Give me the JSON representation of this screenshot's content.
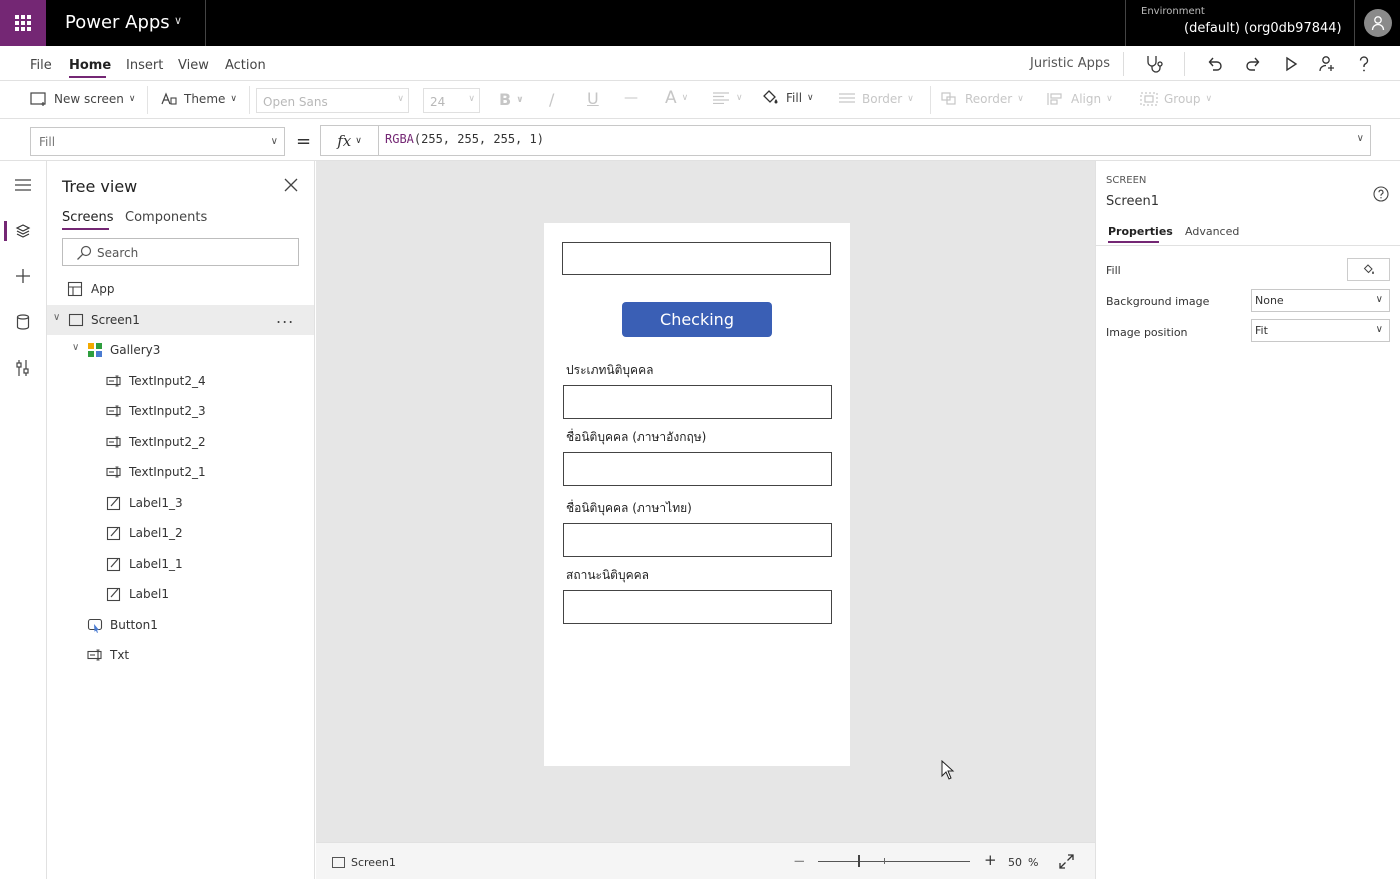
{
  "header": {
    "app_title": "Power Apps",
    "environment_label": "Environment",
    "environment_value": "(default) (org0db97844)"
  },
  "menu": {
    "items": [
      "File",
      "Home",
      "Insert",
      "View",
      "Action"
    ],
    "active": "Home",
    "app_name": "Juristic Apps"
  },
  "ribbon": {
    "new_screen": "New screen",
    "theme": "Theme",
    "font": "Open Sans",
    "font_size": "24",
    "bold": "B",
    "italic": "/",
    "underline": "U",
    "strike": "—",
    "font_color": "A",
    "fill": "Fill",
    "border": "Border",
    "reorder": "Reorder",
    "align": "Align",
    "group": "Group"
  },
  "formula": {
    "property": "Fill",
    "equals": "=",
    "fx": "fx",
    "fn_name": "RGBA",
    "args": "(255, 255, 255, 1)"
  },
  "tree": {
    "title": "Tree view",
    "tabs": [
      "Screens",
      "Components"
    ],
    "search_placeholder": "Search",
    "more": "...",
    "items": [
      {
        "label": "App",
        "icon": "app-icon"
      },
      {
        "label": "Screen1",
        "icon": "screen-icon"
      },
      {
        "label": "Gallery3",
        "icon": "gallery-icon"
      },
      {
        "label": "TextInput2_4",
        "icon": "text-input-icon"
      },
      {
        "label": "TextInput2_3",
        "icon": "text-input-icon"
      },
      {
        "label": "TextInput2_2",
        "icon": "text-input-icon"
      },
      {
        "label": "TextInput2_1",
        "icon": "text-input-icon"
      },
      {
        "label": "Label1_3",
        "icon": "label-icon"
      },
      {
        "label": "Label1_2",
        "icon": "label-icon"
      },
      {
        "label": "Label1_1",
        "icon": "label-icon"
      },
      {
        "label": "Label1",
        "icon": "label-icon"
      },
      {
        "label": "Button1",
        "icon": "button-icon"
      },
      {
        "label": "Txt",
        "icon": "text-input-icon"
      }
    ]
  },
  "canvas": {
    "button_label": "Checking",
    "labels": [
      "ประเภทนิติบุคคล",
      "ชื่อนิติบุคคล (ภาษาอังกฤษ)",
      "ชื่อนิติบุคคล (ภาษาไทย)",
      "สถานะนิติบุคคล"
    ],
    "button_color": "#3a5fb5"
  },
  "status": {
    "screen": "Screen1",
    "zoom": "50",
    "zoom_unit": "%",
    "zoom_fraction": 0.26
  },
  "properties": {
    "kind": "SCREEN",
    "name": "Screen1",
    "tabs": [
      "Properties",
      "Advanced"
    ],
    "fill_label": "Fill",
    "bg_image_label": "Background image",
    "bg_image_value": "None",
    "image_position_label": "Image position",
    "image_position_value": "Fit"
  },
  "colors": {
    "accent": "#742774",
    "header_bg": "#000000"
  }
}
